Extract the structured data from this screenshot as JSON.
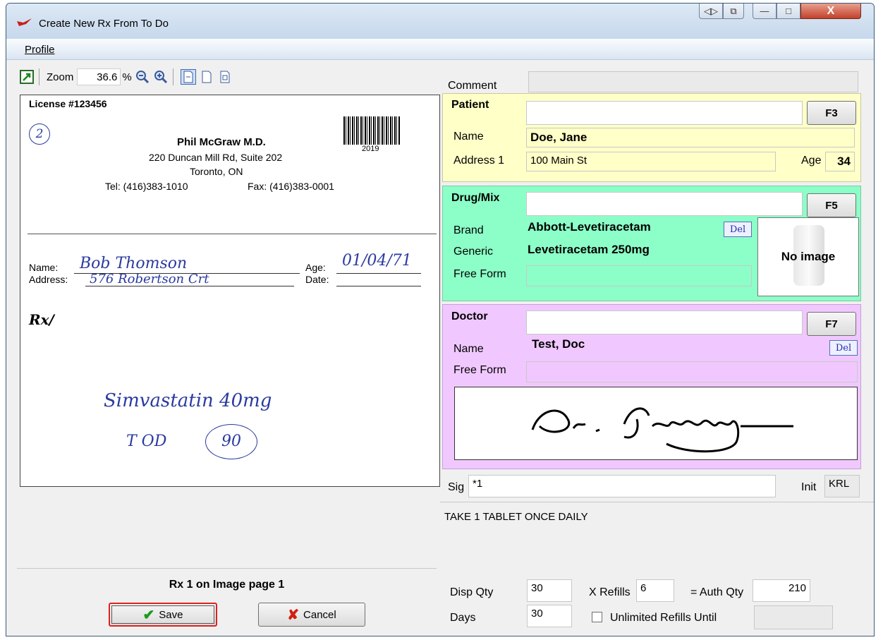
{
  "window": {
    "title": "Create New Rx From To Do",
    "minimize_label": "—",
    "maximize_label": "□",
    "close_label": "X"
  },
  "menu": {
    "profile": "Profile"
  },
  "toolbar": {
    "zoom_label": "Zoom",
    "zoom_value": "36.6",
    "zoom_unit": "%"
  },
  "document": {
    "license": "License #123456",
    "circle_number": "2",
    "doctor_name": "Phil McGraw M.D.",
    "address_line1": "220 Duncan Mill Rd, Suite 202",
    "address_line2": "Toronto, ON",
    "tel": "Tel: (416)383-1010",
    "fax": "Fax: (416)383-0001",
    "barcode_year": "2019",
    "name_label": "Name:",
    "address_label": "Address:",
    "age_label": "Age:",
    "date_label": "Date:",
    "patient_hand": "Bob Thomson",
    "address_hand": "576 Robertson Crt",
    "age_hand": "01/04/71",
    "rx_label": "Rx/",
    "drug_hand": "Simvastatin 40mg",
    "directions_hand": "T OD",
    "qty_hand": "90"
  },
  "left_footer": {
    "rx_page": "Rx 1 on Image page 1",
    "save_label": "Save",
    "cancel_label": "Cancel"
  },
  "comment": {
    "label": "Comment",
    "value": ""
  },
  "patient": {
    "title": "Patient",
    "key": "F3",
    "name_label": "Name",
    "name": "Doe, Jane",
    "address_label": "Address 1",
    "address": "100 Main St",
    "age_label": "Age",
    "age": "34"
  },
  "drug": {
    "title": "Drug/Mix",
    "key": "F5",
    "brand_label": "Brand",
    "brand": "Abbott-Levetiracetam",
    "generic_label": "Generic",
    "generic": "Levetiracetam 250mg",
    "freeform_label": "Free Form",
    "del_label": "Del",
    "no_image": "No image"
  },
  "doctor": {
    "title": "Doctor",
    "key": "F7",
    "name_label": "Name",
    "name": "Test, Doc",
    "freeform_label": "Free Form",
    "del_label": "Del"
  },
  "sig": {
    "label": "Sig",
    "value": "*1",
    "init_label": "Init",
    "init_value": "KRL",
    "text": "TAKE 1 TABLET ONCE DAILY"
  },
  "quantities": {
    "disp_label": "Disp Qty",
    "disp_value": "30",
    "refills_label": "X Refills",
    "refills_value": "6",
    "auth_label": "= Auth Qty",
    "auth_value": "210",
    "days_label": "Days",
    "days_value": "30",
    "unlimited_label": "Unlimited Refills Until",
    "unlimited_value": ""
  },
  "colors": {
    "patient_bg": "#ffffc8",
    "drug_bg": "#8cffc8",
    "doctor_bg": "#f0c8ff",
    "save_border": "#e02020"
  }
}
